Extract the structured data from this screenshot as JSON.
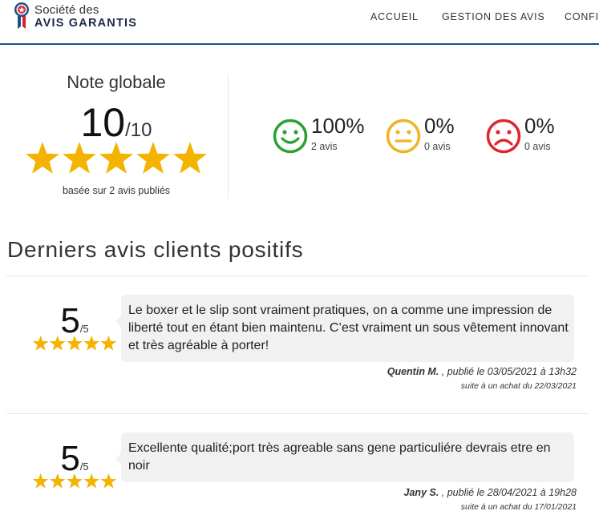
{
  "header": {
    "logo": {
      "line1": "Société des",
      "line2": "AVIS GARANTIS",
      "colors": {
        "blue": "#1f4e8c",
        "red": "#d6212c"
      }
    },
    "nav": [
      {
        "label": "ACCUEIL"
      },
      {
        "label": "GESTION DES AVIS"
      },
      {
        "label": "CONFIG"
      }
    ]
  },
  "global_rating": {
    "title": "Note globale",
    "score": "10",
    "out_of": "/10",
    "stars": 5,
    "based_on": "basée sur 2 avis publiés",
    "star_color": "#f5b301"
  },
  "sentiment": [
    {
      "type": "positive",
      "icon": "smiley-happy-icon",
      "percent": "100%",
      "count": "2 avis",
      "color": "#2aa232"
    },
    {
      "type": "neutral",
      "icon": "smiley-neutral-icon",
      "percent": "0%",
      "count": "0 avis",
      "color": "#f0b323"
    },
    {
      "type": "negative",
      "icon": "smiley-sad-icon",
      "percent": "0%",
      "count": "0 avis",
      "color": "#e0262c"
    }
  ],
  "reviews_section": {
    "title": "Derniers avis clients positifs",
    "reviews": [
      {
        "score": "5",
        "out_of": "/5",
        "stars": 5,
        "text": "Le boxer et le slip sont vraiment pratiques, on a comme une impression de liberté tout en étant bien maintenu. C’est vraiment un sous vêtement innovant et très agréable à porter!",
        "author": "Quentin M.",
        "published": " , publié le 03/05/2021 à 13h32",
        "purchase": "suite à un achat du 22/03/2021"
      },
      {
        "score": "5",
        "out_of": "/5",
        "stars": 5,
        "text": "Excellente qualité;port très agreable sans gene particuliére devrais etre en noir",
        "author": "Jany S.",
        "published": " , publié le 28/04/2021 à 19h28",
        "purchase": "suite à un achat du 17/01/2021"
      }
    ]
  }
}
